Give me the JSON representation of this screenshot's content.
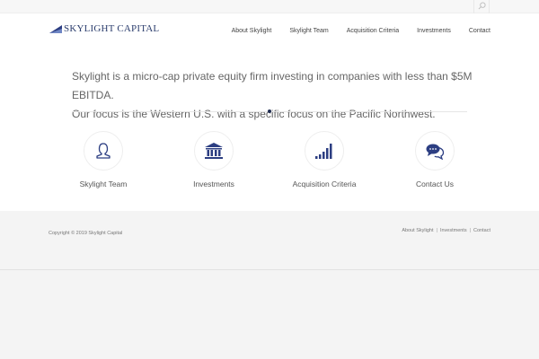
{
  "brand": {
    "name": "SKYLIGHT CAPITAL"
  },
  "nav": {
    "items": [
      {
        "label": "About Skylight"
      },
      {
        "label": "Skylight Team"
      },
      {
        "label": "Acquisition Criteria"
      },
      {
        "label": "Investments"
      },
      {
        "label": "Contact"
      }
    ]
  },
  "intro": {
    "line1": "Skylight is a micro-cap private equity firm investing in companies with less than $5M EBITDA.",
    "line2": "Our focus is the Western U.S. with a specific focus on the Pacific Northwest."
  },
  "features": [
    {
      "label": "Skylight Team",
      "icon": "person-icon"
    },
    {
      "label": "Investments",
      "icon": "bank-icon"
    },
    {
      "label": "Acquisition Criteria",
      "icon": "signal-bars-icon"
    },
    {
      "label": "Contact Us",
      "icon": "chat-bubbles-icon"
    }
  ],
  "footer": {
    "copyright": "Copyright © 2019 Skylight Capital",
    "links": [
      {
        "label": "About Skylight"
      },
      {
        "label": "Investments"
      },
      {
        "label": "Contact"
      }
    ]
  },
  "colors": {
    "accent": "#2c3e82",
    "brand_text": "#2c3e6e",
    "body_text": "#666666"
  }
}
